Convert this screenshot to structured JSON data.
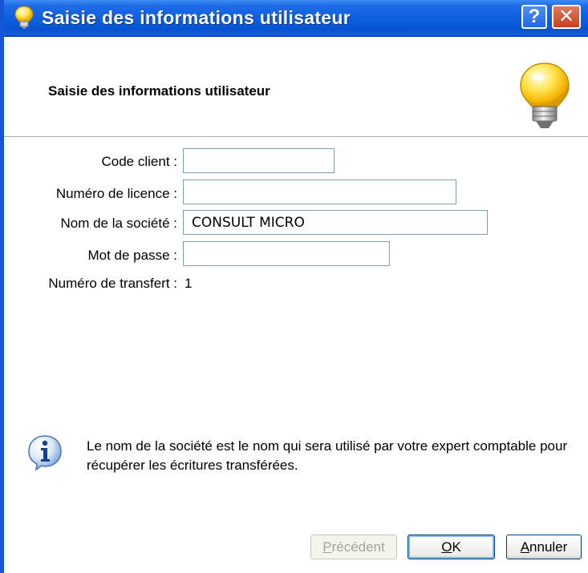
{
  "window": {
    "title": "Saisie des informations utilisateur",
    "help_glyph": "?",
    "close_glyph": "✕",
    "title_icon": "lightbulb-icon"
  },
  "header": {
    "title": "Saisie des informations utilisateur",
    "icon": "lightbulb-icon"
  },
  "form": {
    "code_client": {
      "label": "Code client :",
      "value": ""
    },
    "licence": {
      "label": "Numéro de licence :",
      "value": ""
    },
    "societe": {
      "label": "Nom de la société :",
      "value": "CONSULT MICRO"
    },
    "password": {
      "label": "Mot de passe :",
      "value": ""
    },
    "transfert": {
      "label": "Numéro de transfert :",
      "value": "1"
    }
  },
  "info": {
    "icon": "info-icon",
    "text": "Le nom de la société est le nom qui sera utilisé par votre expert comptable pour récupérer les écritures transférées."
  },
  "buttons": {
    "previous_first": "P",
    "previous_rest": "récédent",
    "ok_first": "O",
    "ok_rest": "K",
    "cancel_first": "A",
    "cancel_rest": "nnuler"
  },
  "colors": {
    "titlebar": "#0a5fe0",
    "accent": "#1456d6"
  }
}
